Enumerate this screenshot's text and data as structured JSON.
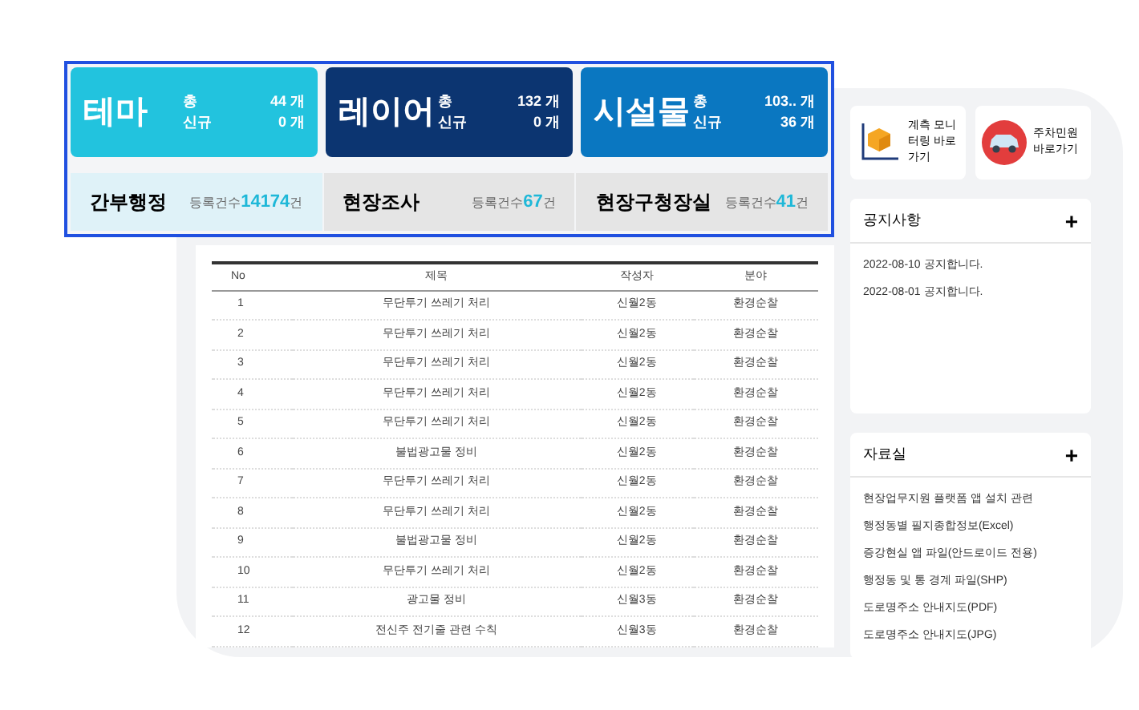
{
  "summary_cards": [
    {
      "title": "테마",
      "color": "#22c3de",
      "total_label": "총",
      "total": "44 개",
      "new_label": "신규",
      "new": "0 개"
    },
    {
      "title": "레이어",
      "color": "#0c3571",
      "total_label": "총",
      "total": "132 개",
      "new_label": "신규",
      "new": "0 개"
    },
    {
      "title": "시설물",
      "color": "#0a77c1",
      "total_label": "총",
      "total": "103.. 개",
      "new_label": "신규",
      "new": "36 개"
    }
  ],
  "count_tabs": [
    {
      "label": "간부행정",
      "prefix": "등록건수",
      "count": "14174",
      "suffix": "건",
      "selected": true
    },
    {
      "label": "현장조사",
      "prefix": "등록건수",
      "count": "67",
      "suffix": "건",
      "selected": false
    },
    {
      "label": "현장구청장실",
      "prefix": "등록건수",
      "count": "41",
      "suffix": "건",
      "selected": false
    }
  ],
  "table": {
    "columns": [
      "No",
      "제목",
      "작성자",
      "분야"
    ],
    "rows": [
      [
        "1",
        "무단투기 쓰레기 처리",
        "신월2동",
        "환경순찰"
      ],
      [
        "2",
        "무단투기 쓰레기 처리",
        "신월2동",
        "환경순찰"
      ],
      [
        "3",
        "무단투기 쓰레기 처리",
        "신월2동",
        "환경순찰"
      ],
      [
        "4",
        "무단투기 쓰레기 처리",
        "신월2동",
        "환경순찰"
      ],
      [
        "5",
        "무단투기 쓰레기 처리",
        "신월2동",
        "환경순찰"
      ],
      [
        "6",
        "불법광고물 정비",
        "신월2동",
        "환경순찰"
      ],
      [
        "7",
        "무단투기 쓰레기 처리",
        "신월2동",
        "환경순찰"
      ],
      [
        "8",
        "무단투기 쓰레기 처리",
        "신월2동",
        "환경순찰"
      ],
      [
        "9",
        "불법광고물 정비",
        "신월2동",
        "환경순찰"
      ],
      [
        "10",
        "무단투기 쓰레기 처리",
        "신월2동",
        "환경순찰"
      ],
      [
        "11",
        "광고물 정비",
        "신월3동",
        "환경순찰"
      ],
      [
        "12",
        "전신주 전기줄 관련 수칙",
        "신월3동",
        "환경순찰"
      ]
    ]
  },
  "shortcuts": [
    {
      "kind": "cube",
      "label": "계측 모니터링 바로가기"
    },
    {
      "kind": "car",
      "label": "주차민원 바로가기"
    }
  ],
  "notices": {
    "title": "공지사항",
    "add": "+",
    "items": [
      "2022-08-10 공지합니다.",
      "2022-08-01 공지합니다."
    ]
  },
  "archive": {
    "title": "자료실",
    "add": "+",
    "items": [
      "현장업무지원 플랫폼 앱 설치 관련",
      "행정동별 필지종합정보(Excel)",
      "증강현실 앱 파일(안드로이드 전용)",
      "행정동 및 통 경계 파일(SHP)",
      "도로명주소 안내지도(PDF)",
      "도로명주소 안내지도(JPG)"
    ]
  }
}
